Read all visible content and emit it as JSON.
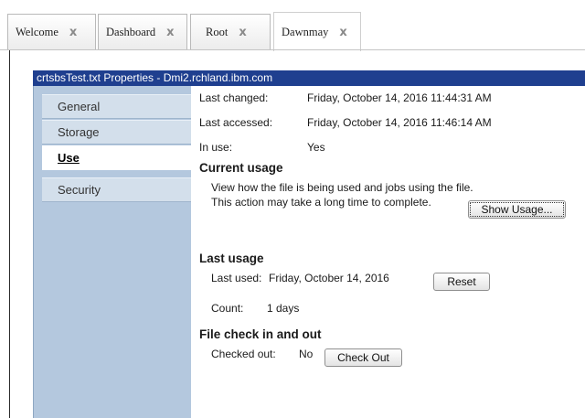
{
  "tabs": [
    {
      "label": "Welcome"
    },
    {
      "label": "Dashboard"
    },
    {
      "label": "Root"
    },
    {
      "label": "Dawnmay"
    }
  ],
  "tab_close_glyph": "x",
  "window": {
    "title": "crtsbsTest.txt Properties - Dmi2.rchland.ibm.com"
  },
  "nav": {
    "items": [
      {
        "label": "General"
      },
      {
        "label": "Storage"
      },
      {
        "label": "Use",
        "active": true
      },
      {
        "label": "Security"
      }
    ]
  },
  "info": {
    "last_changed_label": "Last changed:",
    "last_changed_value": "Friday, October 14, 2016 11:44:31 AM",
    "last_accessed_label": "Last accessed:",
    "last_accessed_value": "Friday, October 14, 2016 11:46:14 AM",
    "in_use_label": "In use:",
    "in_use_value": "Yes"
  },
  "current_usage": {
    "heading": "Current usage",
    "description": "View how the file is being used and jobs using the file. This action may take a long time to complete.",
    "button": "Show Usage..."
  },
  "last_usage": {
    "heading": "Last usage",
    "last_used_label": "Last used:",
    "last_used_value": "Friday, October 14, 2016",
    "reset_button": "Reset",
    "count_label": "Count:",
    "count_value": "1 days"
  },
  "check": {
    "heading": "File check in and out",
    "checked_out_label": "Checked out:",
    "checked_out_value": "No",
    "button": "Check Out"
  },
  "colors": {
    "titlebar": "#1f3f8f",
    "nav_pane": "#b4c8de",
    "nav_item": "#d3dfeb"
  }
}
